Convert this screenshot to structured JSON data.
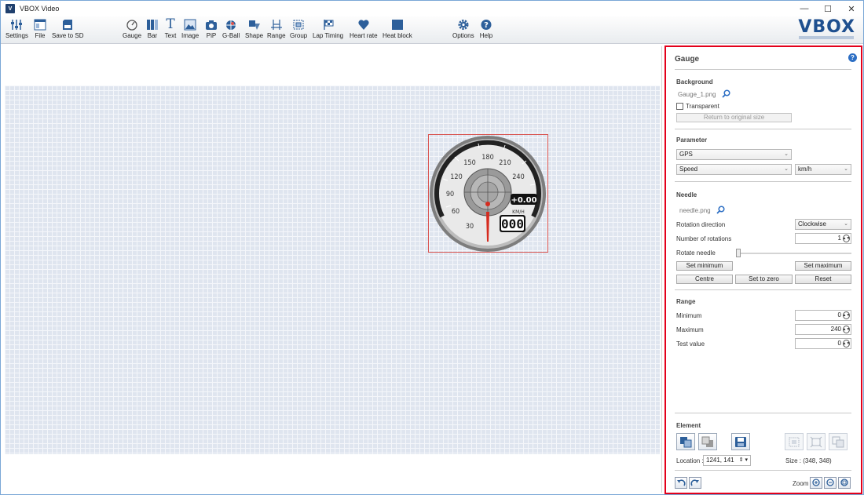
{
  "window": {
    "title": "VBOX Video",
    "minimize": "—",
    "maximize": "☐",
    "close": "✕"
  },
  "toolbar": {
    "items": [
      {
        "label": "Settings",
        "icon": "sliders-icon"
      },
      {
        "label": "File",
        "icon": "file-icon"
      },
      {
        "label": "Save to SD",
        "icon": "sd-card-icon"
      },
      {
        "label": "Gauge",
        "icon": "gauge-icon"
      },
      {
        "label": "Bar",
        "icon": "bar-icon"
      },
      {
        "label": "Text",
        "icon": "text-icon"
      },
      {
        "label": "Image",
        "icon": "image-icon"
      },
      {
        "label": "PiP",
        "icon": "camera-icon"
      },
      {
        "label": "G-Ball",
        "icon": "g-ball-icon"
      },
      {
        "label": "Shape",
        "icon": "shape-icon"
      },
      {
        "label": "Range",
        "icon": "range-icon"
      },
      {
        "label": "Group",
        "icon": "group-icon"
      },
      {
        "label": "Lap Timing",
        "icon": "checkered-flag-icon"
      },
      {
        "label": "Heart rate",
        "icon": "heart-icon"
      },
      {
        "label": "Heat block",
        "icon": "heat-block-icon"
      },
      {
        "label": "Options",
        "icon": "gear-icon"
      },
      {
        "label": "Help",
        "icon": "help-icon"
      }
    ],
    "logo": "VBOX"
  },
  "gauge_widget": {
    "scale_labels": [
      "30",
      "60",
      "90",
      "120",
      "150",
      "180",
      "210",
      "240"
    ],
    "offset_readout": "+0.00",
    "unit": "KM/H",
    "digital_readout": "000"
  },
  "panel": {
    "title": "Gauge",
    "background": {
      "heading": "Background",
      "file": "Gauge_1.png",
      "transparent_label": "Transparent",
      "transparent_checked": false,
      "return_button": "Return to original size"
    },
    "parameter": {
      "heading": "Parameter",
      "source": "GPS",
      "channel": "Speed",
      "unit": "km/h"
    },
    "needle": {
      "heading": "Needle",
      "file": "needle.png",
      "rotation_direction_label": "Rotation direction",
      "rotation_direction_value": "Clockwise",
      "rotations_label": "Number of rotations",
      "rotations_value": "1",
      "rotate_label": "Rotate needle",
      "set_minimum": "Set minimum",
      "set_maximum": "Set maximum",
      "centre": "Centre",
      "set_to_zero": "Set to zero",
      "reset": "Reset"
    },
    "range": {
      "heading": "Range",
      "minimum_label": "Minimum",
      "minimum_value": "0",
      "maximum_label": "Maximum",
      "maximum_value": "240",
      "test_label": "Test value",
      "test_value": "0"
    },
    "element": {
      "heading": "Element",
      "location_label": "Location :",
      "location_value": "1241, 141",
      "size_text": "Size : (348, 348)"
    },
    "footer": {
      "zoom_label": "Zoom"
    }
  },
  "colors": {
    "accent": "#1e4f8f",
    "selection_border": "#e3001b",
    "grid": "#dfe5ef"
  }
}
